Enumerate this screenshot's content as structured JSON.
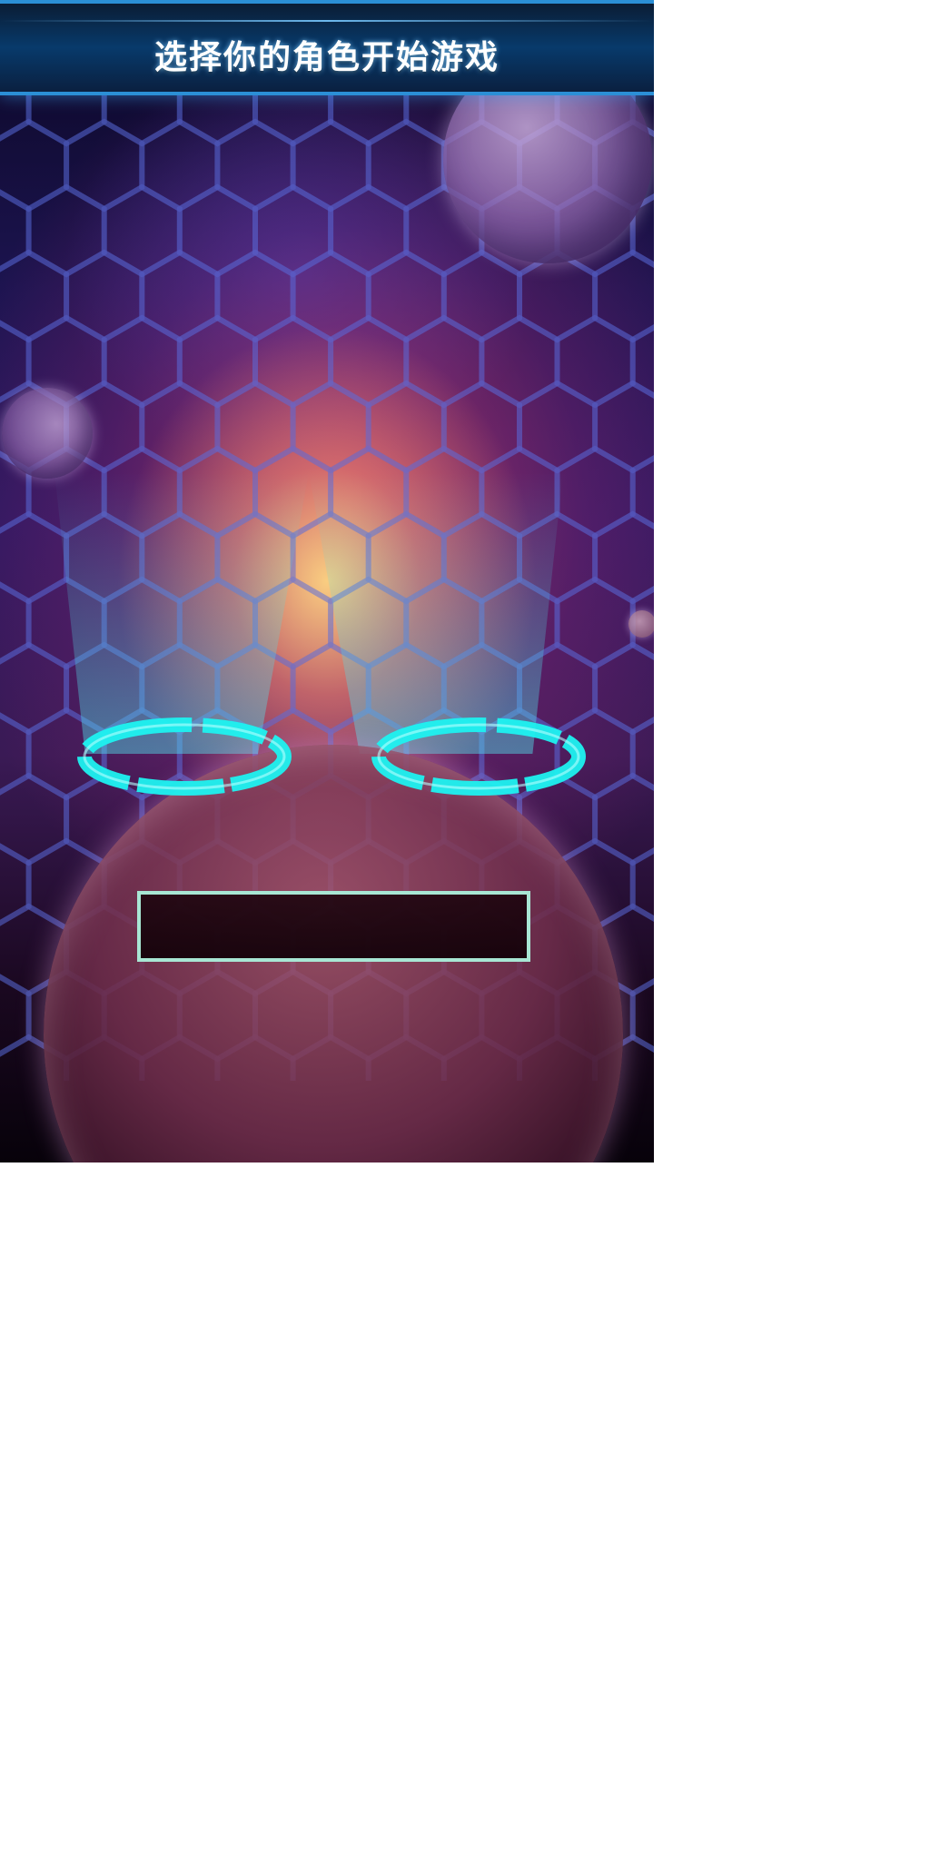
{
  "title": "选择你的角色开始游戏",
  "name_input": {
    "value": "",
    "placeholder": ""
  },
  "colors": {
    "title_bar_accent": "#2b8fd6",
    "ring_cyan": "#1ef2f0",
    "name_box_border": "#a8e6d4"
  },
  "icons": [
    "ring-pedestal-icon",
    "ring-pedestal-icon"
  ]
}
